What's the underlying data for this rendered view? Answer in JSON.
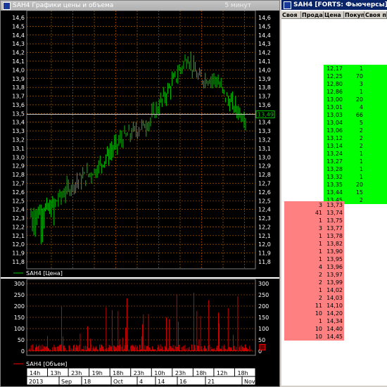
{
  "chart_window": {
    "title": "SAH4 Графики цены и объема",
    "timeframe": "5 минут",
    "price_legend": "SAH4 [Цена]",
    "volume_legend": "SAH4 [Объем]",
    "last_price_label": "13,49",
    "price_ticks": [
      "14,6",
      "14,5",
      "14,4",
      "14,3",
      "14,2",
      "14,1",
      "14,0",
      "13,9",
      "13,8",
      "13,7",
      "13,6",
      "13,5",
      "13,4",
      "13,3",
      "13,2",
      "13,1",
      "13,0",
      "12,9",
      "12,8",
      "12,7",
      "12,6",
      "12,5",
      "12,4",
      "12,3",
      "12,2",
      "12,1",
      "12,0",
      "11,9",
      "11,8"
    ],
    "volume_ticks": [
      "300",
      "250",
      "200",
      "150",
      "100",
      "50",
      "0"
    ],
    "time_labels": [
      "14h",
      "13h",
      "23h",
      "19h",
      "18h",
      "23h",
      "10h",
      "23h",
      "18h",
      "12h",
      "18h"
    ],
    "date_labels": [
      "2013",
      "Sep",
      "18",
      "Oct",
      "4",
      "14",
      "16",
      "21",
      "Nov"
    ],
    "colors": {
      "price": "#00c800",
      "volume": "#ff0000",
      "grid": "#c86400",
      "last_price_line": "#c0c0c0"
    }
  },
  "book_window": {
    "title": "SAH4 [FORTS: Фьючерсы]",
    "headers": [
      "Своя",
      "Прода",
      "Цена",
      "Покуп",
      "Своя п"
    ],
    "bids": [
      {
        "price": "12,17",
        "qty": "1"
      },
      {
        "price": "12,25",
        "qty": "70"
      },
      {
        "price": "12,80",
        "qty": "3"
      },
      {
        "price": "12,86",
        "qty": "1"
      },
      {
        "price": "13,00",
        "qty": "20"
      },
      {
        "price": "13,01",
        "qty": "4"
      },
      {
        "price": "13,03",
        "qty": "66"
      },
      {
        "price": "13,04",
        "qty": "5"
      },
      {
        "price": "13,06",
        "qty": "2"
      },
      {
        "price": "13,12",
        "qty": "2"
      },
      {
        "price": "13,14",
        "qty": "2"
      },
      {
        "price": "13,24",
        "qty": "1"
      },
      {
        "price": "13,27",
        "qty": "1"
      },
      {
        "price": "13,28",
        "qty": "1"
      },
      {
        "price": "13,32",
        "qty": "1"
      },
      {
        "price": "13,35",
        "qty": "20"
      },
      {
        "price": "13,44",
        "qty": "15"
      },
      {
        "price": "13,45",
        "qty": "2"
      }
    ],
    "asks": [
      {
        "qty": "3",
        "price": "13,73"
      },
      {
        "qty": "41",
        "price": "13,74"
      },
      {
        "qty": "1",
        "price": "13,75"
      },
      {
        "qty": "3",
        "price": "13,77"
      },
      {
        "qty": "1",
        "price": "13,78"
      },
      {
        "qty": "1",
        "price": "13,82"
      },
      {
        "qty": "1",
        "price": "13,90"
      },
      {
        "qty": "1",
        "price": "13,95"
      },
      {
        "qty": "4",
        "price": "13,96"
      },
      {
        "qty": "2",
        "price": "13,97"
      },
      {
        "qty": "2",
        "price": "13,99"
      },
      {
        "qty": "1",
        "price": "14,02"
      },
      {
        "qty": "2",
        "price": "14,03"
      },
      {
        "qty": "11",
        "price": "14,10"
      },
      {
        "qty": "10",
        "price": "14,20"
      },
      {
        "qty": "1",
        "price": "14,34"
      },
      {
        "qty": "10",
        "price": "14,40"
      },
      {
        "qty": "10",
        "price": "14,45"
      }
    ],
    "colors": {
      "bid": "#00ff00",
      "ask": "#ff8080"
    }
  }
}
